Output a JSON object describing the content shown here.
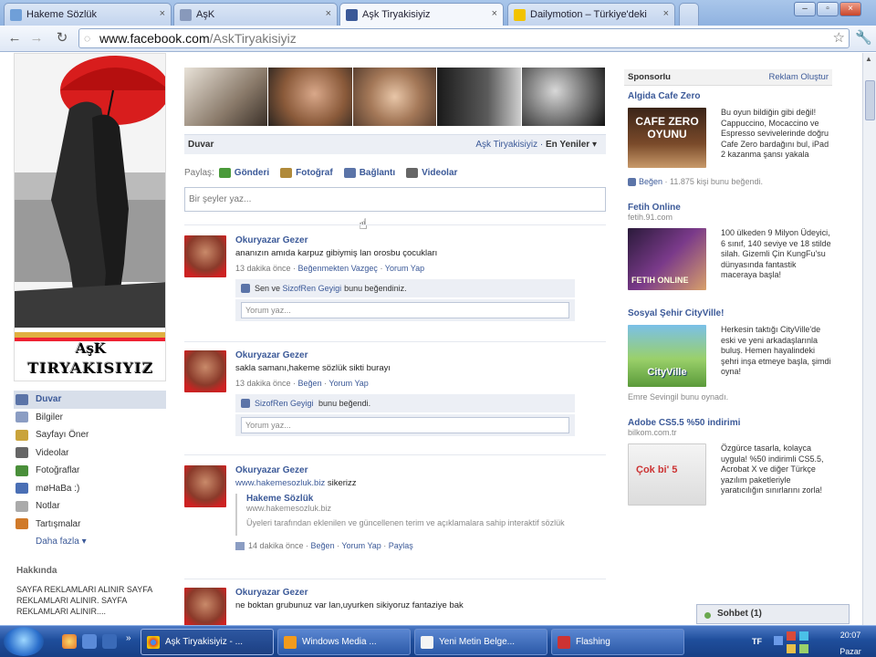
{
  "browser": {
    "tabs": [
      {
        "label": "Hakeme Sözlük",
        "favicon_color": "#6f9fd8"
      },
      {
        "label": "AşK",
        "favicon_color": "#8899bb"
      },
      {
        "label": "Aşk Tiryakisiyiz",
        "favicon_color": "#3b5998"
      },
      {
        "label": "Dailymotion – Türkiye'deki",
        "favicon_color": "#f2c300"
      }
    ],
    "url_host": "www.facebook.com",
    "url_path": "/AskTiryakisiyiz"
  },
  "profile": {
    "banner_line1": "AşK",
    "banner_line2": "TIRYAKISIYIZ",
    "nav": [
      {
        "label": "Duvar",
        "icon": "wall-icon",
        "color": "#5b74a8"
      },
      {
        "label": "Bilgiler",
        "icon": "info-icon",
        "color": "#8b9dc3"
      },
      {
        "label": "Sayfayı Öner",
        "icon": "suggest-icon",
        "color": "#c9a33b"
      },
      {
        "label": "Videolar",
        "icon": "video-icon",
        "color": "#666666"
      },
      {
        "label": "Fotoğraflar",
        "icon": "photo-icon",
        "color": "#4a8f3a"
      },
      {
        "label": "møHaBa :)",
        "icon": "app-icon",
        "color": "#4a6fb5"
      },
      {
        "label": "Notlar",
        "icon": "notes-icon",
        "color": "#aaaaaa"
      },
      {
        "label": "Tartışmalar",
        "icon": "discussion-icon",
        "color": "#d07a2a"
      }
    ],
    "more_label": "Daha fazla ▾",
    "about_title": "Hakkında",
    "about_text": "SAYFA REKLAMLARI ALINIR SAYFA REKLAMLARI ALINIR. SAYFA REKLAMLARI ALINIR...."
  },
  "wall": {
    "title": "Duvar",
    "filter_page": "Aşk Tiryakisiyiz",
    "filter_mode": "En Yeniler ▾",
    "share_label": "Paylaş:",
    "share_options": [
      {
        "label": "Gönderi",
        "color": "#4a9a3a"
      },
      {
        "label": "Fotoğraf",
        "color": "#b08a3a"
      },
      {
        "label": "Bağlantı",
        "color": "#5b74a8"
      },
      {
        "label": "Videolar",
        "color": "#666666"
      }
    ],
    "composer_placeholder": "Bir şeyler yaz...",
    "posts": [
      {
        "author": "Okuryazar Gezer",
        "message": "ananızın amıda karpuz gibiymiş lan orosbu çocukları",
        "time": "13 dakika önce",
        "actions": [
          "Beğenmekten Vazgeç",
          "Yorum Yap"
        ],
        "likes_prefix": "Sen ve",
        "likes_name": "SizofRen Geyigi",
        "likes_suffix": "bunu beğendiniz.",
        "comment_placeholder": "Yorum yaz..."
      },
      {
        "author": "Okuryazar Gezer",
        "message": "sakla samanı,hakeme sözlük sikti burayı",
        "time": "13 dakika önce",
        "actions": [
          "Beğen",
          "Yorum Yap"
        ],
        "likes_prefix": "",
        "likes_name": "SizofRen Geyigi",
        "likes_suffix": "bunu beğendi.",
        "comment_placeholder": "Yorum yaz..."
      },
      {
        "author": "Okuryazar Gezer",
        "link": "www.hakemesozluk.biz",
        "message_suffix": "sikerizz",
        "shared_title": "Hakeme Sözlük",
        "shared_url": "www.hakemesozluk.biz",
        "shared_desc": "Üyeleri tarafından eklenilen ve güncellenen terim ve açıklamalara sahip interaktif sözlük",
        "time": "14 dakika önce",
        "actions": [
          "Beğen",
          "Yorum Yap",
          "Paylaş"
        ]
      },
      {
        "author": "Okuryazar Gezer",
        "message": "ne boktan grubunuz var lan,uyurken sikiyoruz fantaziye bak"
      }
    ]
  },
  "ads": {
    "header": "Sponsorlu",
    "create": "Reklam Oluştur",
    "items": [
      {
        "title": "Algida Cafe Zero",
        "url": "",
        "text": "Bu oyun bildiğin gibi değil! Cappuccino, Mocaccino ve Espresso sevivelerinde doğru Cafe Zero bardağını bul, iPad 2 kazanma şansı yakala",
        "like_label": "Beğen",
        "like_count": "· 11.875 kişi bunu beğendi.",
        "img_label": "CAFE ZERO OYUNU"
      },
      {
        "title": "Fetih Online",
        "url": "fetih.91.com",
        "text": "100 ülkeden 9 Milyon Üdeyici, 6 sınıf, 140 seviye ve 18 stilde silah. Gizemli Çin KungFu'su dünyasında fantastik maceraya başla!",
        "img_label": "FETIH ONLINE"
      },
      {
        "title": "Sosyal Şehir CityVille!",
        "url": "",
        "text": "Herkesin taktığı CityVille'de eski ve yeni arkadaşlarınla buluş. Hemen hayalindeki şehri inşa etmeye başla, şimdi oyna!",
        "social": "Emre Sevingil bunu oynadı.",
        "img_label": "CityVille"
      },
      {
        "title": "Adobe CS5.5 %50 indirimi",
        "url": "bilkom.com.tr",
        "text": "Özgürce tasarla, kolayca uygula! %50 indirimli CS5.5, Acrobat X ve diğer Türkçe yazılım paketleriyle yaratıcılığın sınırlarını zorla!",
        "img_label": "Çok bi' 5"
      }
    ]
  },
  "chat": {
    "label": "Sohbet (1)"
  },
  "taskbar": {
    "buttons": [
      {
        "label": "Aşk Tiryakisiyiz - ...",
        "icon_color": "#e34a2f"
      },
      {
        "label": "Windows Media ...",
        "icon_color": "#f29b1d"
      },
      {
        "label": "Yeni Metin Belge...",
        "icon_color": "#f4f4f4"
      },
      {
        "label": "Flashing",
        "icon_color": "#c33"
      }
    ],
    "lang": "TF",
    "time": "20:07",
    "day": "Pazar"
  }
}
